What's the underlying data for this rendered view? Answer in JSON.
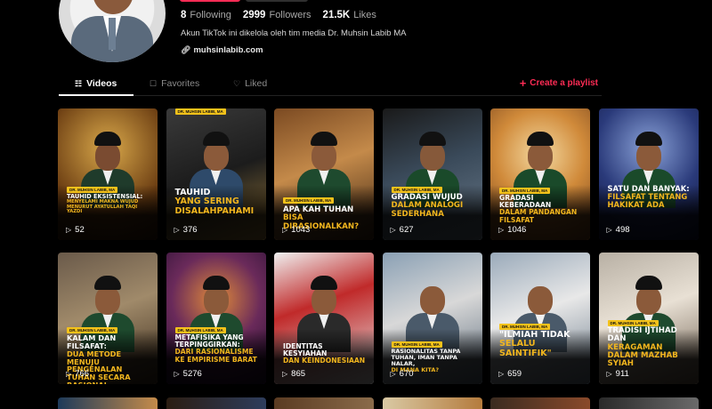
{
  "profile": {
    "following_count": "8",
    "following_label": "Following",
    "followers_count": "2999",
    "followers_label": "Followers",
    "likes_count": "21.5K",
    "likes_label": "Likes",
    "bio": "Akun TikTok ini dikelola oleh tim media Dr. Muhsin Labib MA",
    "link": "muhsinlabib.com"
  },
  "tabs": {
    "videos": "Videos",
    "favorites": "Favorites",
    "liked": "Liked",
    "create_playlist": "Create a playlist"
  },
  "colors": {
    "accent": "#fe2c55",
    "title_gold": "#f2b61e",
    "tag_yellow": "#f4c21a"
  },
  "videos": [
    {
      "tag": "DR. MUHSIN LABIB, MA",
      "line1": "TAUHID EKSISTENSIAL:",
      "line2": "MENYELAMI MAKNA WUJUD MENURUT AYATULLAH TAQI YAZDI",
      "views": "52"
    },
    {
      "tag": "DR. MUHSIN LABIB, MA",
      "line1": "TAUHID",
      "line2": "YANG SERING DISALAHPAHAMI",
      "views": "376"
    },
    {
      "tag": "DR. MUHSIN LABIB, MA",
      "line1": "APA KAH TUHAN",
      "line2": "BISA DIRASIONALKAN?",
      "views": "1043"
    },
    {
      "tag": "DR. MUHSIN LABIB, MA",
      "line1": "GRADASI WUJUD",
      "line2": "DALAM ANALOGI SEDERHANA",
      "views": "627"
    },
    {
      "tag": "DR. MUHSIN LABIB, MA",
      "line1": "GRADASI KEBERADAAN",
      "line2": "DALAM PANDANGAN FILSAFAT",
      "views": "1046"
    },
    {
      "tag": "",
      "line1": "SATU DAN BANYAK:",
      "line2": "FILSAFAT TENTANG HAKIKAT ADA",
      "views": "498"
    },
    {
      "tag": "DR. MUHSIN LABIB, MA",
      "line1": "KALAM DAN FILSAFAT:",
      "line2": "DUA METODE MENUJU PENGENALAN TUHAN SECARA RASIONAL",
      "views": "766"
    },
    {
      "tag": "DR. MUHSIN LABIB, MA",
      "line1": "METAFISIKA YANG TERPINGGIRKAN:",
      "line2": "DARI RASIONALISME KE EMPIRISME BARAT",
      "views": "5276"
    },
    {
      "tag": "",
      "line1": "IDENTITAS KESYIAHAN",
      "line2": "DAN KEINDONESIAAN",
      "views": "865"
    },
    {
      "tag": "DR. MUHSIN LABIB, MA",
      "line1": "RASIONALITAS TANPA TUHAN, IMAN TANPA NALAR,",
      "line2": "DI MANA KITA?",
      "views": "670"
    },
    {
      "tag": "DR. MUHSIN LABIB, MA",
      "line1": "\"ILMIAH TIDAK",
      "line2": "SELALU SAINTIFIK\"",
      "views": "659"
    },
    {
      "tag": "DR. MUHSIN LABIB, MA",
      "line1": "TRADISI IJTIHAD DAN",
      "line2": "KERAGAMAN DALAM MAZHAB SYIAH",
      "views": "911"
    }
  ],
  "icons": {
    "link": "link-icon",
    "videos_tab": "grid-icon",
    "favorites_tab": "bookmark-icon",
    "liked_tab": "heart-icon",
    "play": "play-icon",
    "plus": "plus-icon"
  }
}
